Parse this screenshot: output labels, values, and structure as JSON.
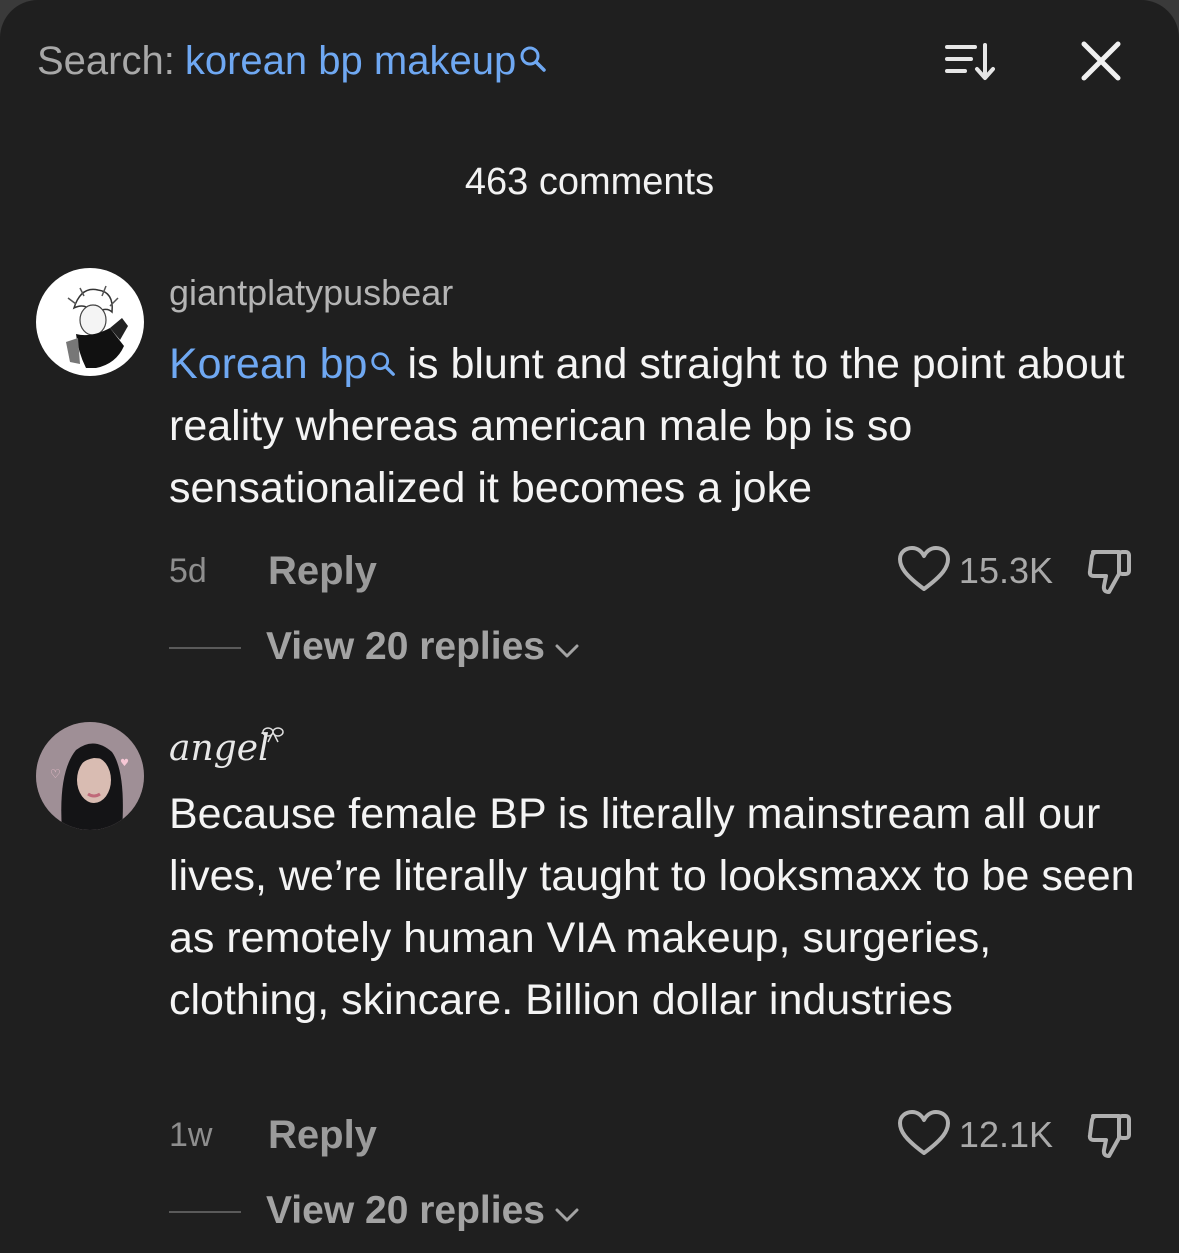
{
  "header": {
    "search_prefix": "Search:",
    "search_query": "korean bp makeup",
    "sort_icon": "sort-descending-icon",
    "close_icon": "close-icon"
  },
  "comment_count": "463 comments",
  "colors": {
    "background": "#1f1f1f",
    "keyword_blue": "#6fa8f2",
    "muted_text": "#a8a8a8"
  },
  "comments": [
    {
      "username": "giantplatypusbear",
      "keyword": "Korean bp",
      "text": "is blunt and straight to the point about reality whereas american male bp is so sensationalized it becomes a joke",
      "time": "5d",
      "reply_label": "Reply",
      "likes": "15.3K",
      "view_replies": "View 20 replies"
    },
    {
      "username": "angel",
      "text": "Because female BP is literally mainstream all our lives, we’re literally taught to looksmaxx to be seen as remotely human VIA makeup, surgeries, clothing, skincare. Billion dollar industries",
      "time": "1w",
      "reply_label": "Reply",
      "likes": "12.1K",
      "view_replies": "View 20 replies"
    }
  ]
}
